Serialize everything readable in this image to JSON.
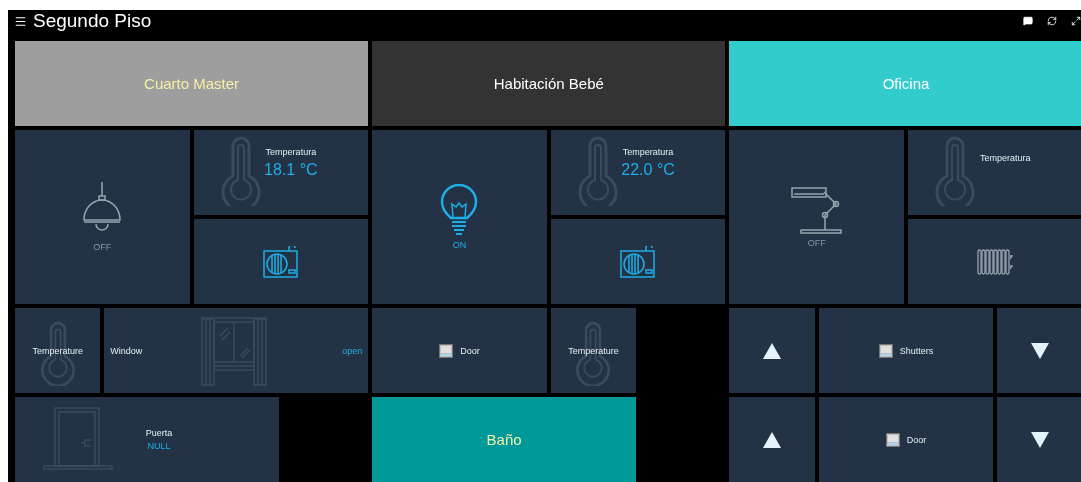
{
  "header": {
    "title": "Segundo Piso"
  },
  "tiles": [
    {
      "kind": "room",
      "label": "Cuarto Master",
      "color": "#9e9e9e",
      "active": true
    },
    {
      "kind": "room",
      "label": "Habitación Bebé",
      "color": "#333333",
      "active": false
    },
    {
      "kind": "room",
      "label": "Oficina",
      "color": "#33cccc",
      "active": false
    },
    {
      "kind": "pendant-light",
      "on": false,
      "status": "OFF"
    },
    {
      "kind": "temperature",
      "label": "Temperatura",
      "value": "18.1 °C"
    },
    {
      "kind": "air-conditioner",
      "on": true
    },
    {
      "kind": "bulb",
      "on": true,
      "status": "ON"
    },
    {
      "kind": "temperature",
      "label": "Temperatura",
      "value": "22.0 °C"
    },
    {
      "kind": "air-conditioner",
      "on": true
    },
    {
      "kind": "desk-lamp",
      "on": false,
      "status": "OFF"
    },
    {
      "kind": "temperature",
      "label": "Temperatura"
    },
    {
      "kind": "radiator",
      "on": false
    },
    {
      "kind": "temperature",
      "label": "Temperature"
    },
    {
      "kind": "window",
      "label": "Window",
      "status": "open"
    },
    {
      "kind": "blind",
      "label": "Door"
    },
    {
      "kind": "temperature",
      "label": "Temperature"
    },
    {
      "kind": "up"
    },
    {
      "kind": "blind",
      "label": "Shutters"
    },
    {
      "kind": "down"
    },
    {
      "kind": "door",
      "label": "Puerta",
      "value": "NULL"
    },
    {
      "kind": "room",
      "label": "Baño",
      "color": "#009999",
      "active": true
    },
    {
      "kind": "up"
    },
    {
      "kind": "blind",
      "label": "Door"
    },
    {
      "kind": "down"
    }
  ]
}
